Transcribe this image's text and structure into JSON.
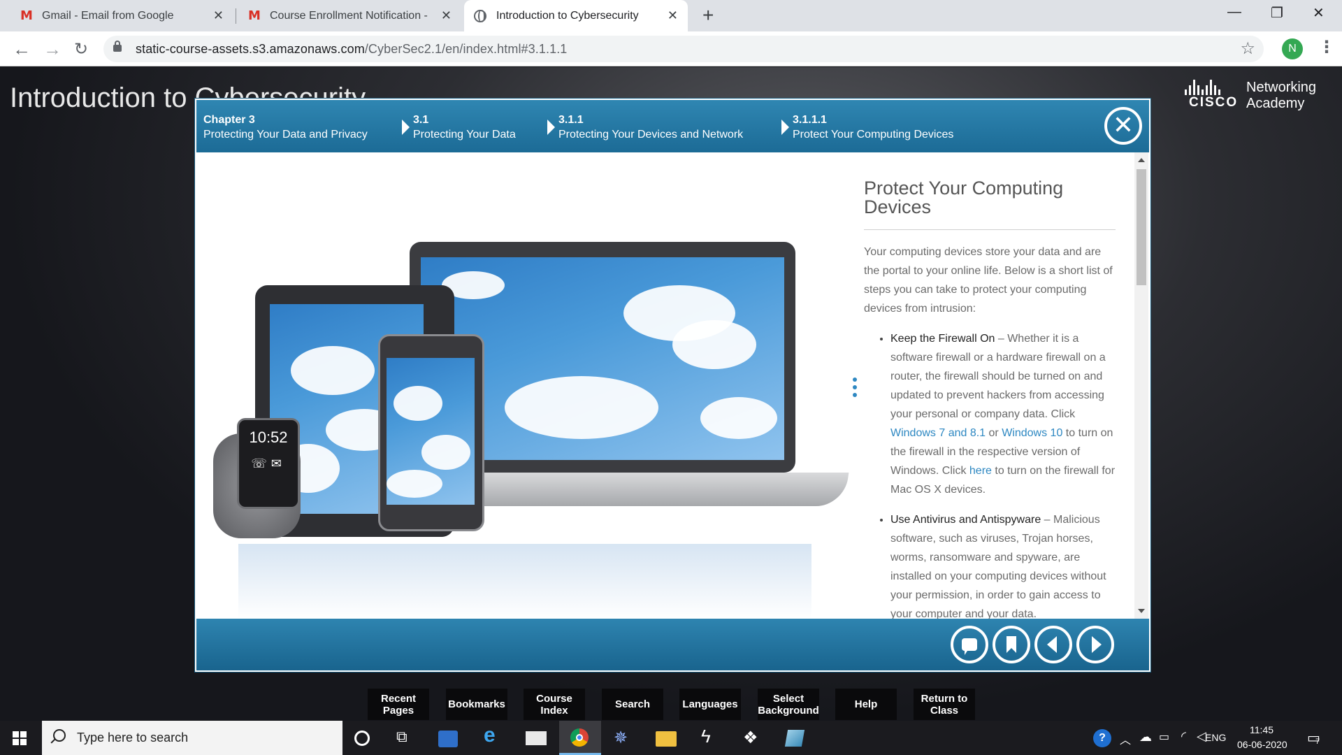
{
  "browser": {
    "tabs": [
      {
        "title": "Gmail - Email from Google",
        "icon": "gmail-icon",
        "active": false
      },
      {
        "title": "Course Enrollment Notification -",
        "icon": "gmail-icon",
        "active": false
      },
      {
        "title": "Introduction to Cybersecurity",
        "icon": "globe-icon",
        "active": true
      }
    ],
    "url_host": "static-course-assets.s3.amazonaws.com",
    "url_path": "/CyberSec2.1/en/index.html#3.1.1.1",
    "profile_initial": "N"
  },
  "page": {
    "title": "Introduction to Cybersecurity",
    "logo_word": "CISCO",
    "logo_line1": "Networking",
    "logo_line2": "Academy"
  },
  "breadcrumb": [
    {
      "num": "Chapter 3",
      "label": "Protecting Your Data and Privacy"
    },
    {
      "num": "3.1",
      "label": "Protecting Your Data"
    },
    {
      "num": "3.1.1",
      "label": "Protecting Your Devices and Network"
    },
    {
      "num": "3.1.1.1",
      "label": "Protect Your Computing Devices"
    }
  ],
  "article": {
    "heading": "Protect Your Computing Devices",
    "intro": "Your computing devices store your data and are the portal to your online life. Below is a short list of steps you can take to protect your computing devices from intrusion:",
    "items": [
      {
        "lead": "Keep the Firewall On",
        "text1": " – Whether it is a software firewall or a hardware firewall on a router, the firewall should be turned on and updated to prevent hackers from accessing your personal or company data. Click ",
        "link1": "Windows 7 and 8.1",
        "text2": " or ",
        "link2": "Windows 10",
        "text3": " to turn on the firewall in the respective version of Windows. Click ",
        "link3": "here",
        "text4": " to turn on the firewall for Mac OS X devices."
      },
      {
        "lead": "Use Antivirus and Antispyware",
        "text1": " – Malicious software, such as viruses, Trojan horses, worms, ransomware and spyware, are installed on your computing devices without your permission, in order to gain access to your computer and your data."
      }
    ]
  },
  "watch_time": "10:52",
  "toolbar": [
    {
      "label": "Recent Pages"
    },
    {
      "label": "Bookmarks"
    },
    {
      "label": "Course Index"
    },
    {
      "label": "Search"
    },
    {
      "label": "Languages"
    },
    {
      "label": "Select Background"
    },
    {
      "label": "Help"
    },
    {
      "label": "Return to Class"
    }
  ],
  "taskbar": {
    "search_placeholder": "Type here to search",
    "lang": "ENG",
    "time": "11:45",
    "date": "06-06-2020",
    "notif_count": "7"
  },
  "colors": {
    "accent": "#2e88c2",
    "header": "#1c6b96"
  }
}
